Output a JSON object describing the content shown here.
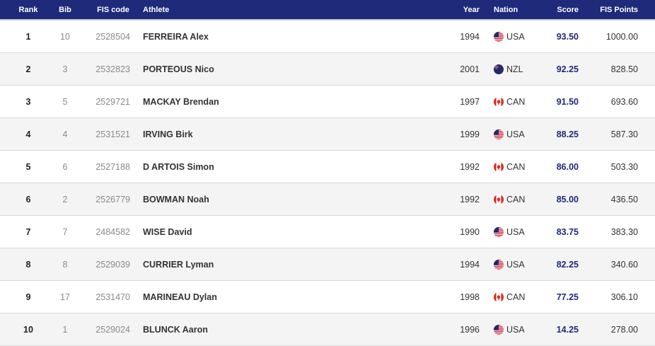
{
  "header": {
    "rank": "Rank",
    "bib": "Bib",
    "fis_code": "FIS code",
    "athlete": "Athlete",
    "year": "Year",
    "nation": "Nation",
    "score": "Score",
    "fis_points": "FIS Points"
  },
  "rows": [
    {
      "rank": "1",
      "bib": "10",
      "fis_code": "2528504",
      "athlete": "FERREIRA Alex",
      "year": "1994",
      "nation": "USA",
      "flag_icon": "usa-flag-icon",
      "score": "93.50",
      "fis_points": "1000.00"
    },
    {
      "rank": "2",
      "bib": "3",
      "fis_code": "2532823",
      "athlete": "PORTEOUS Nico",
      "year": "2001",
      "nation": "NZL",
      "flag_icon": "nzl-flag-icon",
      "score": "92.25",
      "fis_points": "828.50"
    },
    {
      "rank": "3",
      "bib": "5",
      "fis_code": "2529721",
      "athlete": "MACKAY Brendan",
      "year": "1997",
      "nation": "CAN",
      "flag_icon": "can-flag-icon",
      "score": "91.50",
      "fis_points": "693.60"
    },
    {
      "rank": "4",
      "bib": "4",
      "fis_code": "2531521",
      "athlete": "IRVING Birk",
      "year": "1999",
      "nation": "USA",
      "flag_icon": "usa-flag-icon",
      "score": "88.25",
      "fis_points": "587.30"
    },
    {
      "rank": "5",
      "bib": "6",
      "fis_code": "2527188",
      "athlete": "D ARTOIS Simon",
      "year": "1992",
      "nation": "CAN",
      "flag_icon": "can-flag-icon",
      "score": "86.00",
      "fis_points": "503.30"
    },
    {
      "rank": "6",
      "bib": "2",
      "fis_code": "2526779",
      "athlete": "BOWMAN Noah",
      "year": "1992",
      "nation": "CAN",
      "flag_icon": "can-flag-icon",
      "score": "85.00",
      "fis_points": "436.50"
    },
    {
      "rank": "7",
      "bib": "7",
      "fis_code": "2484582",
      "athlete": "WISE David",
      "year": "1990",
      "nation": "USA",
      "flag_icon": "usa-flag-icon",
      "score": "83.75",
      "fis_points": "383.30"
    },
    {
      "rank": "8",
      "bib": "8",
      "fis_code": "2529039",
      "athlete": "CURRIER Lyman",
      "year": "1994",
      "nation": "USA",
      "flag_icon": "usa-flag-icon",
      "score": "82.25",
      "fis_points": "340.60"
    },
    {
      "rank": "9",
      "bib": "17",
      "fis_code": "2531470",
      "athlete": "MARINEAU Dylan",
      "year": "1998",
      "nation": "CAN",
      "flag_icon": "can-flag-icon",
      "score": "77.25",
      "fis_points": "306.10"
    },
    {
      "rank": "10",
      "bib": "1",
      "fis_code": "2529024",
      "athlete": "BLUNCK Aaron",
      "year": "1996",
      "nation": "USA",
      "flag_icon": "usa-flag-icon",
      "score": "14.25",
      "fis_points": "278.00"
    }
  ],
  "colors": {
    "header_bg": "#1f2a7a",
    "score_text": "#1f2a7a",
    "alt_row_bg": "#f4f4f4"
  }
}
